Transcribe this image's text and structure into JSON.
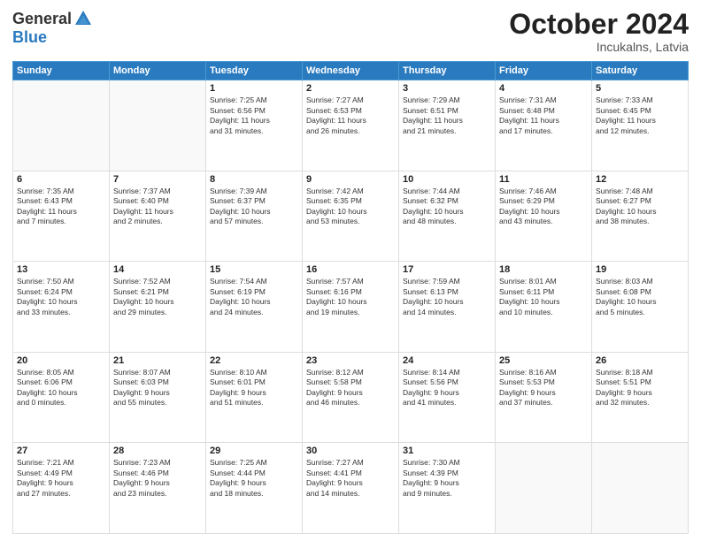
{
  "logo": {
    "general": "General",
    "blue": "Blue"
  },
  "header": {
    "month": "October 2024",
    "location": "Incukalns, Latvia"
  },
  "weekdays": [
    "Sunday",
    "Monday",
    "Tuesday",
    "Wednesday",
    "Thursday",
    "Friday",
    "Saturday"
  ],
  "weeks": [
    [
      {
        "day": "",
        "info": ""
      },
      {
        "day": "",
        "info": ""
      },
      {
        "day": "1",
        "info": "Sunrise: 7:25 AM\nSunset: 6:56 PM\nDaylight: 11 hours\nand 31 minutes."
      },
      {
        "day": "2",
        "info": "Sunrise: 7:27 AM\nSunset: 6:53 PM\nDaylight: 11 hours\nand 26 minutes."
      },
      {
        "day": "3",
        "info": "Sunrise: 7:29 AM\nSunset: 6:51 PM\nDaylight: 11 hours\nand 21 minutes."
      },
      {
        "day": "4",
        "info": "Sunrise: 7:31 AM\nSunset: 6:48 PM\nDaylight: 11 hours\nand 17 minutes."
      },
      {
        "day": "5",
        "info": "Sunrise: 7:33 AM\nSunset: 6:45 PM\nDaylight: 11 hours\nand 12 minutes."
      }
    ],
    [
      {
        "day": "6",
        "info": "Sunrise: 7:35 AM\nSunset: 6:43 PM\nDaylight: 11 hours\nand 7 minutes."
      },
      {
        "day": "7",
        "info": "Sunrise: 7:37 AM\nSunset: 6:40 PM\nDaylight: 11 hours\nand 2 minutes."
      },
      {
        "day": "8",
        "info": "Sunrise: 7:39 AM\nSunset: 6:37 PM\nDaylight: 10 hours\nand 57 minutes."
      },
      {
        "day": "9",
        "info": "Sunrise: 7:42 AM\nSunset: 6:35 PM\nDaylight: 10 hours\nand 53 minutes."
      },
      {
        "day": "10",
        "info": "Sunrise: 7:44 AM\nSunset: 6:32 PM\nDaylight: 10 hours\nand 48 minutes."
      },
      {
        "day": "11",
        "info": "Sunrise: 7:46 AM\nSunset: 6:29 PM\nDaylight: 10 hours\nand 43 minutes."
      },
      {
        "day": "12",
        "info": "Sunrise: 7:48 AM\nSunset: 6:27 PM\nDaylight: 10 hours\nand 38 minutes."
      }
    ],
    [
      {
        "day": "13",
        "info": "Sunrise: 7:50 AM\nSunset: 6:24 PM\nDaylight: 10 hours\nand 33 minutes."
      },
      {
        "day": "14",
        "info": "Sunrise: 7:52 AM\nSunset: 6:21 PM\nDaylight: 10 hours\nand 29 minutes."
      },
      {
        "day": "15",
        "info": "Sunrise: 7:54 AM\nSunset: 6:19 PM\nDaylight: 10 hours\nand 24 minutes."
      },
      {
        "day": "16",
        "info": "Sunrise: 7:57 AM\nSunset: 6:16 PM\nDaylight: 10 hours\nand 19 minutes."
      },
      {
        "day": "17",
        "info": "Sunrise: 7:59 AM\nSunset: 6:13 PM\nDaylight: 10 hours\nand 14 minutes."
      },
      {
        "day": "18",
        "info": "Sunrise: 8:01 AM\nSunset: 6:11 PM\nDaylight: 10 hours\nand 10 minutes."
      },
      {
        "day": "19",
        "info": "Sunrise: 8:03 AM\nSunset: 6:08 PM\nDaylight: 10 hours\nand 5 minutes."
      }
    ],
    [
      {
        "day": "20",
        "info": "Sunrise: 8:05 AM\nSunset: 6:06 PM\nDaylight: 10 hours\nand 0 minutes."
      },
      {
        "day": "21",
        "info": "Sunrise: 8:07 AM\nSunset: 6:03 PM\nDaylight: 9 hours\nand 55 minutes."
      },
      {
        "day": "22",
        "info": "Sunrise: 8:10 AM\nSunset: 6:01 PM\nDaylight: 9 hours\nand 51 minutes."
      },
      {
        "day": "23",
        "info": "Sunrise: 8:12 AM\nSunset: 5:58 PM\nDaylight: 9 hours\nand 46 minutes."
      },
      {
        "day": "24",
        "info": "Sunrise: 8:14 AM\nSunset: 5:56 PM\nDaylight: 9 hours\nand 41 minutes."
      },
      {
        "day": "25",
        "info": "Sunrise: 8:16 AM\nSunset: 5:53 PM\nDaylight: 9 hours\nand 37 minutes."
      },
      {
        "day": "26",
        "info": "Sunrise: 8:18 AM\nSunset: 5:51 PM\nDaylight: 9 hours\nand 32 minutes."
      }
    ],
    [
      {
        "day": "27",
        "info": "Sunrise: 7:21 AM\nSunset: 4:49 PM\nDaylight: 9 hours\nand 27 minutes."
      },
      {
        "day": "28",
        "info": "Sunrise: 7:23 AM\nSunset: 4:46 PM\nDaylight: 9 hours\nand 23 minutes."
      },
      {
        "day": "29",
        "info": "Sunrise: 7:25 AM\nSunset: 4:44 PM\nDaylight: 9 hours\nand 18 minutes."
      },
      {
        "day": "30",
        "info": "Sunrise: 7:27 AM\nSunset: 4:41 PM\nDaylight: 9 hours\nand 14 minutes."
      },
      {
        "day": "31",
        "info": "Sunrise: 7:30 AM\nSunset: 4:39 PM\nDaylight: 9 hours\nand 9 minutes."
      },
      {
        "day": "",
        "info": ""
      },
      {
        "day": "",
        "info": ""
      }
    ]
  ]
}
